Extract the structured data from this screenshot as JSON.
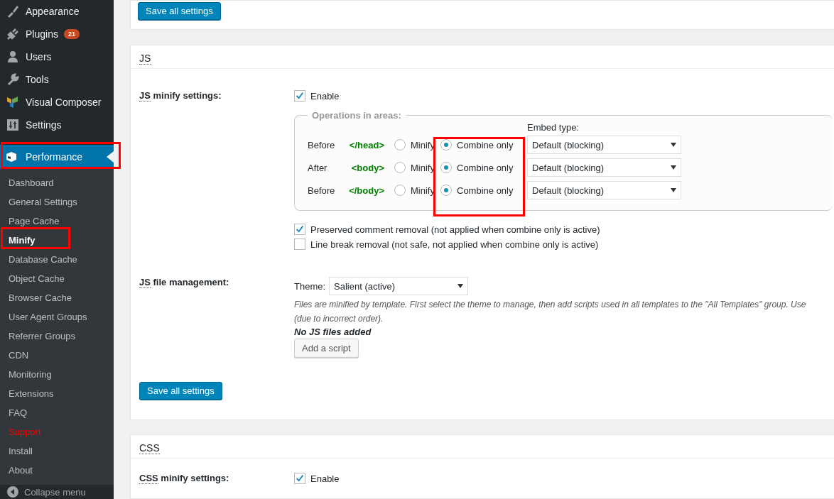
{
  "sidebar": {
    "menu": [
      {
        "label": "Appearance"
      },
      {
        "label": "Plugins",
        "badge": "21"
      },
      {
        "label": "Users"
      },
      {
        "label": "Tools"
      },
      {
        "label": "Visual Composer"
      },
      {
        "label": "Settings"
      }
    ],
    "current": {
      "label": "Performance",
      "selected": true
    },
    "submenu": [
      {
        "label": "Dashboard",
        "kind": "link",
        "selected": false
      },
      {
        "label": "General Settings",
        "kind": "link",
        "selected": false
      },
      {
        "label": "Page Cache",
        "kind": "link",
        "selected": false
      },
      {
        "label": "Minify",
        "kind": "link",
        "selected": true
      },
      {
        "label": "Database Cache",
        "kind": "link",
        "selected": false
      },
      {
        "label": "Object Cache",
        "kind": "link",
        "selected": false
      },
      {
        "label": "Browser Cache",
        "kind": "link",
        "selected": false
      },
      {
        "label": "User Agent Groups",
        "kind": "link",
        "selected": false
      },
      {
        "label": "Referrer Groups",
        "kind": "link",
        "selected": false
      },
      {
        "label": "CDN",
        "kind": "link",
        "selected": false
      },
      {
        "label": "Monitoring",
        "kind": "link",
        "selected": false
      },
      {
        "label": "Extensions",
        "kind": "link",
        "selected": false
      },
      {
        "label": "FAQ",
        "kind": "link",
        "selected": false
      },
      {
        "label": "Support",
        "kind": "alert",
        "selected": false
      },
      {
        "label": "Install",
        "kind": "link",
        "selected": false
      },
      {
        "label": "About",
        "kind": "link",
        "selected": false
      }
    ],
    "collapse": "Collapse menu"
  },
  "top_card": {
    "save_button": "Save all settings"
  },
  "js": {
    "title": "JS",
    "minify_label": "JS minify settings:",
    "enable": {
      "label": "Enable",
      "checked": true
    },
    "operations": {
      "legend": "Operations in areas:",
      "embed_header": "Embed type:",
      "areas": [
        {
          "position": "Before",
          "tag": "</head>",
          "options": [
            {
              "label": "Minify",
              "selected": false
            },
            {
              "label": "Combine only",
              "selected": true
            }
          ],
          "embed": "Default (blocking)"
        },
        {
          "position": "After",
          "tag": "<body>",
          "options": [
            {
              "label": "Minify",
              "selected": false
            },
            {
              "label": "Combine only",
              "selected": true
            }
          ],
          "embed": "Default (blocking)"
        },
        {
          "position": "Before",
          "tag": "</body>",
          "options": [
            {
              "label": "Minify",
              "selected": false
            },
            {
              "label": "Combine only",
              "selected": true
            }
          ],
          "embed": "Default (blocking)"
        }
      ]
    },
    "checkboxes": [
      {
        "label": "Preserved comment removal (not applied when combine only is active)",
        "checked": true
      },
      {
        "label": "Line break removal (not safe, not applied when combine only is active)",
        "checked": false
      }
    ],
    "file_management": {
      "label": "JS file management:",
      "theme_label": "Theme:",
      "theme": "Salient (active)",
      "note_lines": [
        "Files are minified by template. First select the theme to manage, then add scripts used in all templates to the \"All Templates\" group. Use",
        "(due to incorrect order)."
      ],
      "empty": "No JS files added",
      "add_button": "Add a script"
    },
    "save_button": "Save all settings"
  },
  "css": {
    "title": "CSS",
    "minify_label": "CSS minify settings:",
    "enable": {
      "label": "Enable",
      "checked": true
    }
  }
}
